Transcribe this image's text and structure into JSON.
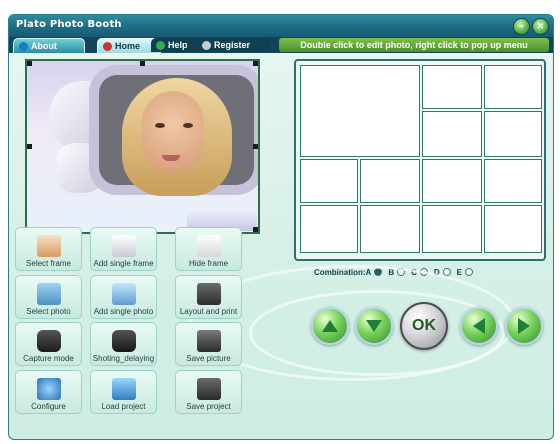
{
  "window": {
    "title": "Plato Photo Booth"
  },
  "tabs": [
    {
      "label": "About"
    },
    {
      "label": "Home"
    },
    {
      "label": "Help"
    },
    {
      "label": "Register"
    }
  ],
  "hint": "Double click to edit photo, right click to pop up menu",
  "combination": {
    "label": "Combination:A",
    "options": [
      "B",
      "C",
      "D",
      "E"
    ]
  },
  "functions": [
    {
      "label": "Select frame",
      "icon": "frame-icon"
    },
    {
      "label": "Add single frame",
      "icon": "add-frame-icon"
    },
    {
      "label": "Hide frame",
      "icon": "hide-frame-icon"
    },
    {
      "label": "Select photo",
      "icon": "photo-icon"
    },
    {
      "label": "Add single photo",
      "icon": "add-photo-icon"
    },
    {
      "label": "Layout and print",
      "icon": "printer-icon"
    },
    {
      "label": "Capture mode",
      "icon": "camera-icon"
    },
    {
      "label": "Shoting_delaying",
      "icon": "camera-timer-icon"
    },
    {
      "label": "Save picture",
      "icon": "save-picture-icon"
    },
    {
      "label": "Configure",
      "icon": "gear-icon"
    },
    {
      "label": "Load project",
      "icon": "load-project-icon"
    },
    {
      "label": "Save project",
      "icon": "save-project-icon"
    }
  ],
  "nav": {
    "ok_label": "OK"
  },
  "colors": {
    "title_bar": "#1e6b86",
    "accent_green": "#4e8f2b",
    "panel_bg": "#d6f0e6"
  }
}
